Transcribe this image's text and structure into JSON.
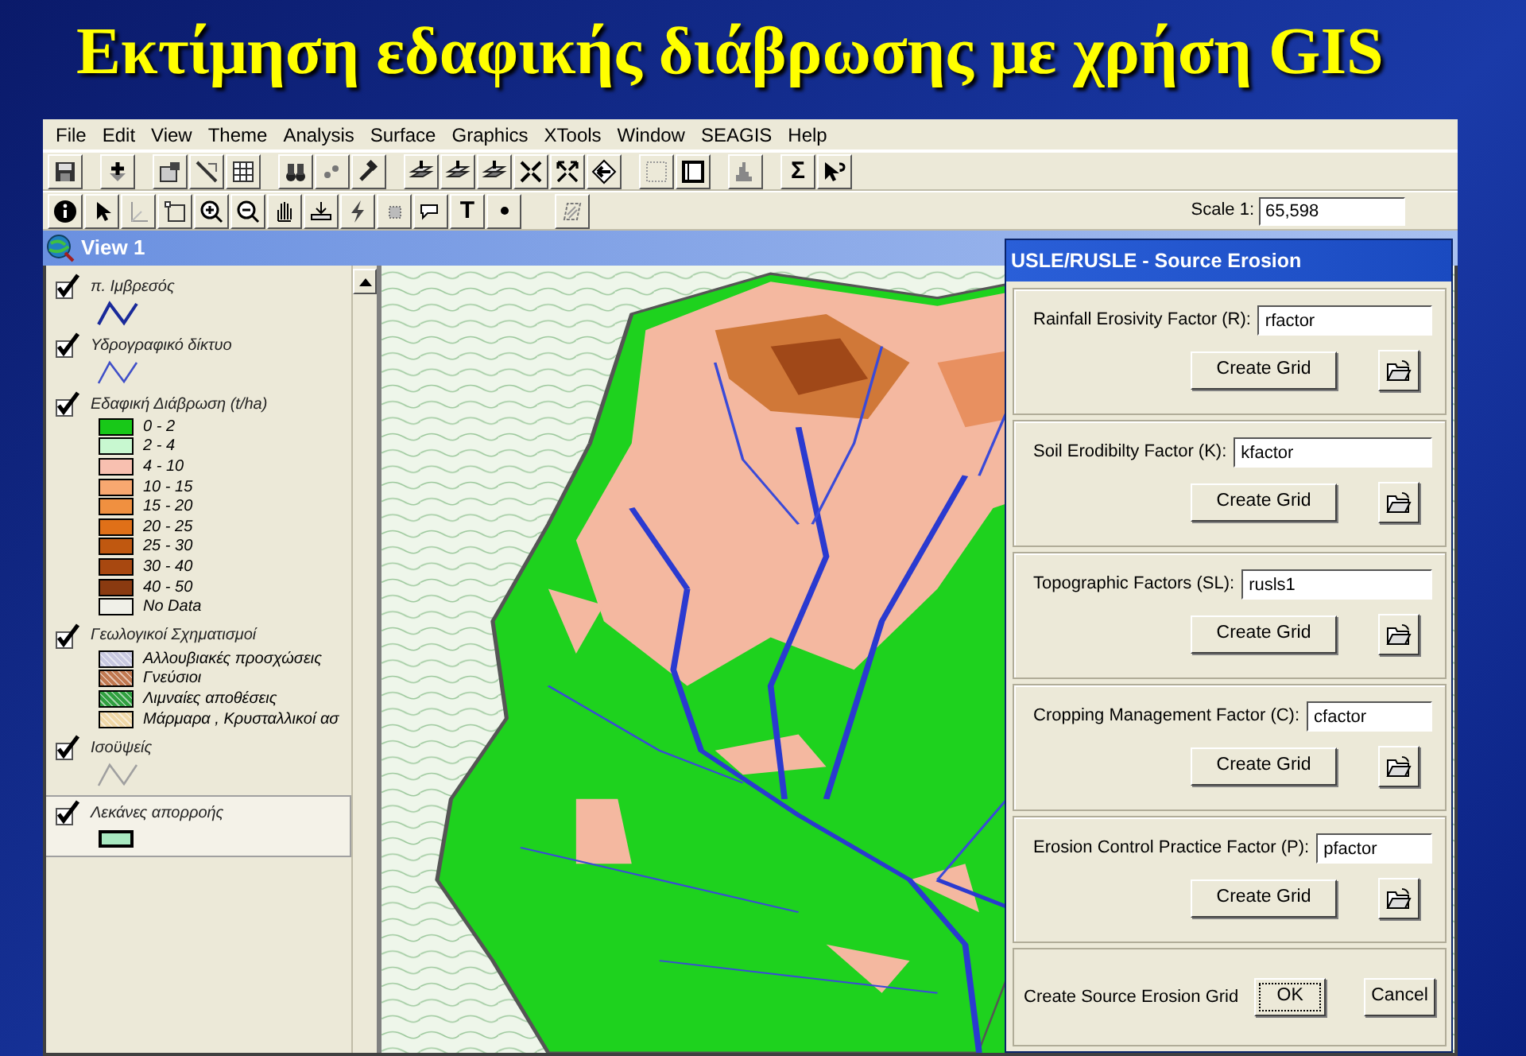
{
  "slide_title": "Εκτίμηση εδαφικής διάβρωσης με χρήση GIS",
  "menu": [
    "File",
    "Edit",
    "View",
    "Theme",
    "Analysis",
    "Surface",
    "Graphics",
    "XTools",
    "Window",
    "SEAGIS",
    "Help"
  ],
  "toolbar_glyphs": [
    "Σ",
    "T"
  ],
  "scale": {
    "label": "Scale 1:",
    "value": "65,598"
  },
  "view": {
    "title": "View 1"
  },
  "legend": [
    {
      "name": "π. Ιμβρεσός",
      "kind": "line",
      "visible": true,
      "active": false,
      "color": "#1a2a9a"
    },
    {
      "name": "Υδρογραφικό δίκτυο",
      "kind": "line",
      "visible": true,
      "active": false,
      "color": "#4050c8"
    },
    {
      "name": "Εδαφική Διάβρωση (t/ha)",
      "kind": "classes",
      "visible": true,
      "active": false,
      "items": [
        {
          "label": "0 - 2",
          "color": "#18c818"
        },
        {
          "label": "2 - 4",
          "color": "#c8f8d0"
        },
        {
          "label": "4 - 10",
          "color": "#f8c0b0"
        },
        {
          "label": "10 - 15",
          "color": "#f8a870"
        },
        {
          "label": "15 - 20",
          "color": "#f09040"
        },
        {
          "label": "20 - 25",
          "color": "#e07018"
        },
        {
          "label": "25 - 30",
          "color": "#c05810"
        },
        {
          "label": "30 - 40",
          "color": "#a84810"
        },
        {
          "label": "40 - 50",
          "color": "#8a3a10"
        },
        {
          "label": "No Data",
          "color": "#f0f0e8"
        }
      ]
    },
    {
      "name": "Γεωλογικοί Σχηματισμοί",
      "kind": "patterns",
      "visible": true,
      "active": false,
      "items": [
        {
          "label": "Αλλουβιακές προσχώσεις",
          "color": "#c8c8e0"
        },
        {
          "label": "Γνεύσιοι",
          "color": "#c07850"
        },
        {
          "label": "Λιμναίες αποθέσεις",
          "color": "#30a040"
        },
        {
          "label": "Μάρμαρα , Κρυσταλλικοί ασ",
          "color": "#f0d8a8"
        }
      ]
    },
    {
      "name": "Ισοϋψείς",
      "kind": "line",
      "visible": true,
      "active": false,
      "color": "#a0a0a0"
    },
    {
      "name": "Λεκάνες απορροής",
      "kind": "fill",
      "visible": true,
      "active": true,
      "color": "#a8e8c0"
    }
  ],
  "dialog": {
    "title": "USLE/RUSLE - Source Erosion",
    "factors": [
      {
        "label": "Rainfall Erosivity Factor (R):",
        "value": "rfactor",
        "button": "Create Grid"
      },
      {
        "label": "Soil Erodibilty Factor (K):",
        "value": "kfactor",
        "button": "Create Grid"
      },
      {
        "label": "Topographic Factors (SL):",
        "value": "rusls1",
        "button": "Create Grid"
      },
      {
        "label": "Cropping Management Factor (C):",
        "value": "cfactor",
        "button": "Create Grid"
      },
      {
        "label": "Erosion Control Practice Factor (P):",
        "value": "pfactor",
        "button": "Create Grid"
      }
    ],
    "footer": {
      "label": "Create Source Erosion Grid",
      "ok": "OK",
      "cancel": "Cancel"
    }
  }
}
